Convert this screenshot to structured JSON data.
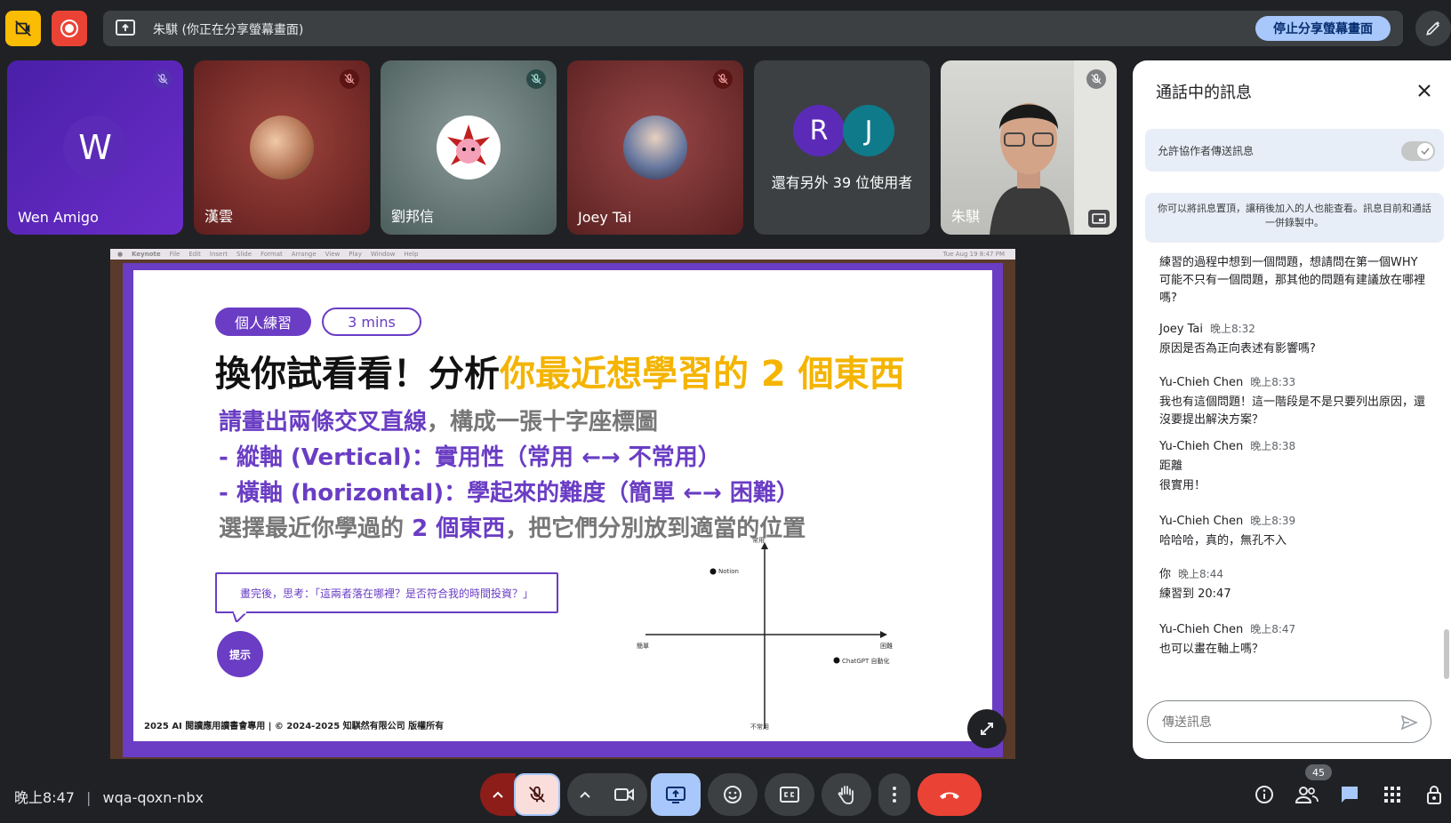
{
  "topbar": {
    "presenter_text": "朱騏 (你正在分享螢幕畫面)",
    "stop_share_label": "停止分享螢幕畫面"
  },
  "participants": [
    {
      "name": "Wen Amigo",
      "initial": "W"
    },
    {
      "name": "漢雲"
    },
    {
      "name": "劉邦信"
    },
    {
      "name": "Joey Tai"
    },
    {
      "name": "還有另外 39 位使用者",
      "initials": [
        "R",
        "J"
      ]
    },
    {
      "name": "朱騏"
    }
  ],
  "slide": {
    "menu_items": [
      "Keynote",
      "File",
      "Edit",
      "Insert",
      "Slide",
      "Format",
      "Arrange",
      "View",
      "Play",
      "Window",
      "Help"
    ],
    "menu_right": "Tue Aug 19  8:47 PM",
    "tag1": "個人練習",
    "tag2": "3 mins",
    "title_black": "換你試看看！分析",
    "title_yellow": "你最近想學習的 2 個東西",
    "line1_purple": "請畫出兩條交叉直線",
    "line1_gray": "，構成一張十字座標圖",
    "line2": "-  縱軸 (Vertical)：實用性（常用 ←→ 不常用）",
    "line3": "-  橫軸 (horizontal)：學起來的難度（簡單 ←→ 困難）",
    "line4_gray1": "選擇最近你學過的 ",
    "line4_purple": "2 個東西",
    "line4_gray2": "，把它們分別放到適當的位置",
    "bubble": "畫完後，思考：「這兩者落在哪裡？是否符合我的時間投資？」",
    "hint": "提示",
    "footer": "2025 AI 閱讀應用讀書會專用 | © 2024-2025 知騏然有限公司 版權所有",
    "axis_top": "常用",
    "axis_bottom": "不常用",
    "axis_left": "簡單",
    "axis_right": "困難",
    "point1": "Notion",
    "point2": "ChatGPT 自動化"
  },
  "chat": {
    "title": "通話中的訊息",
    "toggle_label": "允許協作者傳送訊息",
    "info": "你可以將訊息置頂，讓稍後加入的人也能查看。訊息目前和通話一併錄製中。",
    "messages": [
      {
        "sender": "",
        "time": "",
        "lines": [
          "練習的過程中想到一個問題，想請問在第一個WHY可能不只有一個問題，那其他的問題有建議放在哪裡嗎?"
        ]
      },
      {
        "sender": "Joey Tai",
        "time": "晚上8:32",
        "lines": [
          "原因是否為正向表述有影響嗎?"
        ]
      },
      {
        "sender": "Yu-Chieh Chen",
        "time": "晚上8:33",
        "lines": [
          "我也有這個問題！這一階段是不是只要列出原因，還沒要提出解決方案？"
        ]
      },
      {
        "sender": "Yu-Chieh Chen",
        "time": "晚上8:38",
        "lines": [
          "距離",
          "很實用！"
        ]
      },
      {
        "sender": "Yu-Chieh Chen",
        "time": "晚上8:39",
        "lines": [
          "哈哈哈，真的，無孔不入"
        ]
      },
      {
        "sender": "你",
        "time": "晚上8:44",
        "lines": [
          "練習到 20:47"
        ]
      },
      {
        "sender": "Yu-Chieh Chen",
        "time": "晚上8:47",
        "lines": [
          "也可以畫在軸上嗎？"
        ]
      }
    ],
    "input_placeholder": "傳送訊息"
  },
  "bottom": {
    "time": "晚上8:47",
    "meeting_code": "wqa-qoxn-nbx",
    "people_count": "45"
  },
  "colors": {
    "accent": "#a8c7fa",
    "slide_purple": "#6a3dc4",
    "slide_yellow": "#f4b400",
    "end_call": "#ea4335"
  }
}
